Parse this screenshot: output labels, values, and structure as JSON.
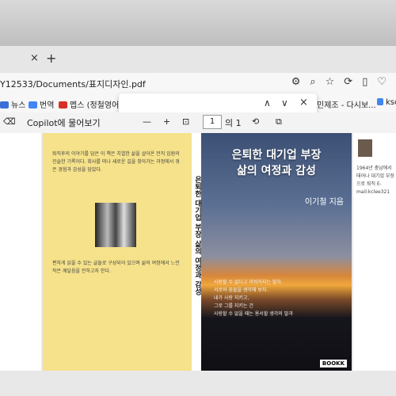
{
  "browser": {
    "tab_close": "×",
    "tab_new": "+",
    "url": "Y12533/Documents/표지디자인.pdf",
    "addr_icons": [
      "⚙",
      "⌕",
      "☆",
      "⟳",
      "▯",
      "♡"
    ]
  },
  "favorites": [
    {
      "label": "뉴스",
      "color": "#3a6fd8"
    },
    {
      "label": "번역",
      "color": "#4285f4"
    },
    {
      "label": "멥스 (정철영어성경",
      "color": "#d93025"
    },
    {
      "label": "민제조 - 다시보...",
      "color": "#2a8a4a"
    },
    {
      "label": "ksc",
      "color": "#4285f4"
    }
  ],
  "find": {
    "up": "∧",
    "down": "∨",
    "close": "×"
  },
  "pdf_toolbar": {
    "eraser_icon": "⌫",
    "copilot": "Copilot에 물어보기",
    "zoom_out": "—",
    "zoom_in": "+",
    "fit": "⊡",
    "page": "1",
    "page_of": "의 1",
    "rotate": "⟲",
    "more": "⧉"
  },
  "book": {
    "back_top_text": "퇴직후의 이야기를 담은 이 책은 치열한 삶을 살아온 전직 임원의 진솔한 기록이다. 회사를 떠나 새로운 길을 찾아가는 과정에서 겪은 경험과 감성을 담았다.",
    "back_bottom_text": "편하게 읽을 수 있는 글들로 구성되어 있으며 삶의 여정에서 느낀 작은 깨달음을 전하고자 한다.",
    "spine_title": "은퇴한 대기업 부장 삶의 여정과 감성",
    "cover_title_1": "은퇴한 대기업 부장",
    "cover_title_2": "삶의 여정과 감성",
    "cover_author": "이기철 지음",
    "cover_lines": [
      "사랑할 수 없다고 미워하지는 말자.",
      "서로의 꿈들을 생각해 보자.",
      "내가 사랑 지키고,",
      "그로 그를 지키는 건",
      "사랑할 수 없을 때는 용서할 생각의 말과"
    ],
    "publisher": "BOOKK",
    "author_bio": "1964년 충남에서 태어나 대기업 부장으로 퇴직 E-mail:kclee321"
  }
}
